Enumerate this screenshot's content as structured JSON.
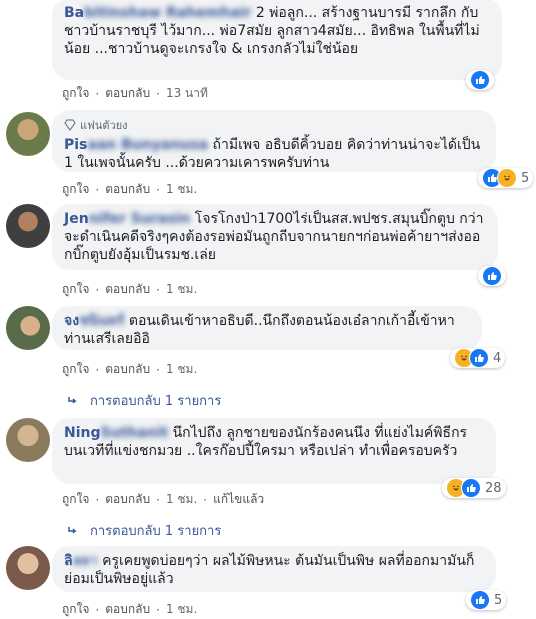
{
  "comments": [
    {
      "name_visible": "Ba",
      "name_hidden": "bitinshaw Rahemhair",
      "text": "2 พ่อลูก... สร้างฐานบารมี รากลึก กับชาวบ้านราชบุรี ไว้มาก... พ่อ7สมัย ลูกสาว4สมัย... อิทธิพล ในพื้นที่ไม่น้อย ...ชาวบ้านดูจะเกรงใจ & เกรงกลัวไม่ใช่น้อย",
      "like_label": "ถูกใจ",
      "reply_label": "ตอบกลับ",
      "time": "13 นาที",
      "reactions": [
        "like"
      ],
      "reaction_count": ""
    },
    {
      "badge": "แฟนตัวยง",
      "name_visible": "Pis",
      "name_hidden": "aan Bunyanusa",
      "text": "ถ้ามีเพจ อธิบดีคิ้วบอย คิดว่าท่านน่าจะได้เป็น 1 ในเพจนั้นครับ ...ด้วยความเคารพครับท่าน",
      "like_label": "ถูกใจ",
      "reply_label": "ตอบกลับ",
      "time": "1 ชม.",
      "reactions": [
        "like",
        "haha"
      ],
      "reaction_count": "5"
    },
    {
      "name_visible": "Jen",
      "name_hidden": "nifer Surasin",
      "text": "โจรโกงป่า1700ไร่เป็นสส.พปชร.สมุนบิ๊กตูบ กว่าจะดำเนินคดีจริงๆคงต้องรอพ่อมันถูกถีบจากนายกฯก่อนพ่อค้ายาฯส่งออกบิ๊กตูบยังอุ้มเป็นรมช.เล่ย",
      "like_label": "ถูกใจ",
      "reply_label": "ตอบกลับ",
      "time": "1 ชม.",
      "reactions": [
        "like"
      ],
      "reaction_count": ""
    },
    {
      "name_visible": "จง",
      "name_hidden": "ชนินทร์",
      "text": "ตอนเดินเข้าหาอธิบดี..นึกถึงตอนน้องเอ๋ลากเก้าอี้เข้าหาท่านเสรีเลยอิอิ",
      "like_label": "ถูกใจ",
      "reply_label": "ตอบกลับ",
      "time": "1 ชม.",
      "reactions": [
        "haha",
        "like"
      ],
      "reaction_count": "4",
      "replies_label": "การตอบกลับ 1 รายการ"
    },
    {
      "name_visible": "Ning",
      "name_hidden": " Suthanit",
      "text": "นึกไปถึง ลูกชายของนักร้องคนนึง ที่แย่งไมค์พิธีกรบนเวทีที่แข่งชกมวย ..ใครก๊อปปี้ใครมา หรือเปล่า ทำเพื่อครอบครัว",
      "like_label": "ถูกใจ",
      "reply_label": "ตอบกลับ",
      "time": "1 ชม.",
      "edited": "แก้ไขแล้ว",
      "reactions": [
        "haha",
        "like"
      ],
      "reaction_count": "28",
      "replies_label": "การตอบกลับ 1 รายการ"
    },
    {
      "name_visible": "ลิ",
      "name_hidden": "ลลา",
      "text": "ครูเคยพูดบ่อยๆว่า ผลไม้พิษหนะ ต้นมันเป็นพิษ ผลที่ออกมามันก็ย่อมเป็นพิษอยู่แล้ว",
      "like_label": "ถูกใจ",
      "reply_label": "ตอบกลับ",
      "time": "1 ชม.",
      "reactions": [
        "like"
      ],
      "reaction_count": "5"
    }
  ],
  "colors": {
    "name": "#385898",
    "bubble": "#f2f3f5",
    "meta": "#606770",
    "like": "#1877f2",
    "haha": "#f7b125"
  }
}
